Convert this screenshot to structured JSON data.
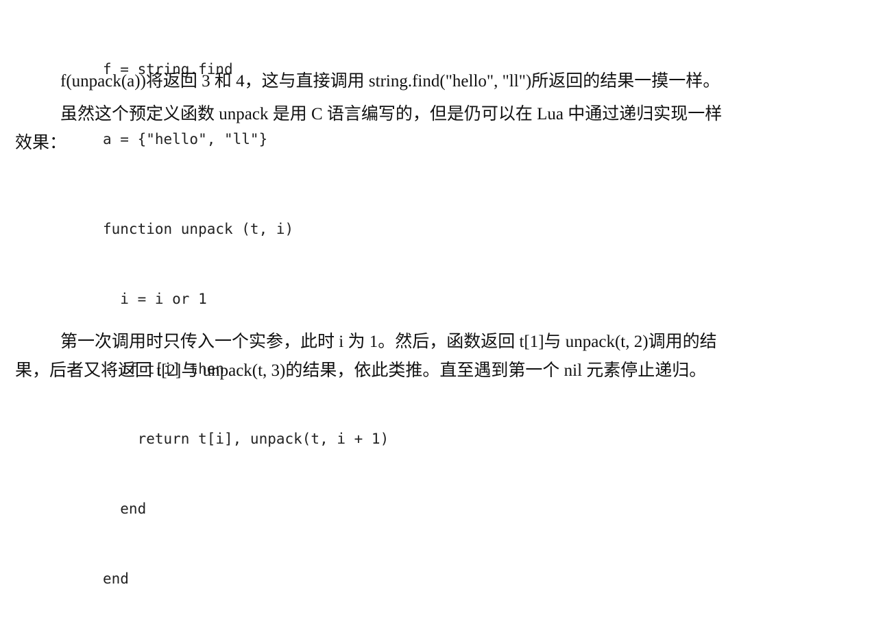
{
  "code_block_1": {
    "lines": [
      "f = string.find",
      "a = {\"hello\", \"ll\"}"
    ]
  },
  "paragraph_1": "f(unpack(a))将返回 3 和 4，这与直接调用 string.find(\"hello\", \"ll\")所返回的结果一摸一样。",
  "paragraph_2": {
    "line_1": "虽然这个预定义函数 unpack 是用 C 语言编写的，但是仍可以在 Lua 中通过递归实现一样",
    "line_2": "效果："
  },
  "code_block_2": {
    "lines": [
      "function unpack (t, i)",
      "  i = i or 1",
      "  if t[i] then",
      "    return t[i], unpack(t, i + 1)",
      "  end",
      "end"
    ]
  },
  "paragraph_3": {
    "line_1": "第一次调用时只传入一个实参，此时 i 为 1。然后，函数返回 t[1]与 unpack(t, 2)调用的结",
    "line_2": "果，后者又将返回 t[2]与 unpack(t, 3)的结果，依此类推。直至遇到第一个 nil 元素停止递归。"
  }
}
